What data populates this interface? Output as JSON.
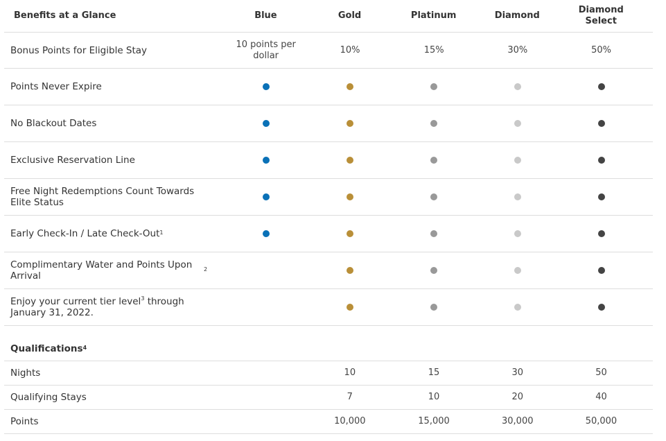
{
  "header": {
    "title": "Benefits at a Glance",
    "tiers": [
      "Blue",
      "Gold",
      "Platinum",
      "Diamond",
      "Diamond Select"
    ]
  },
  "bonus_row": {
    "label": "Bonus Points for Eligible Stay",
    "values": [
      "10 points per dollar",
      "10%",
      "15%",
      "30%",
      "50%"
    ]
  },
  "benefits": [
    {
      "label": "Points Never Expire",
      "sup": "",
      "tiers": [
        true,
        true,
        true,
        true,
        true
      ]
    },
    {
      "label": "No Blackout Dates",
      "sup": "",
      "tiers": [
        true,
        true,
        true,
        true,
        true
      ]
    },
    {
      "label": "Exclusive Reservation Line",
      "sup": "",
      "tiers": [
        true,
        true,
        true,
        true,
        true
      ]
    },
    {
      "label": "Free Night Redemptions Count Towards Elite Status",
      "sup": "",
      "tiers": [
        true,
        true,
        true,
        true,
        true
      ]
    },
    {
      "label": "Early Check-In / Late Check-Out",
      "sup": "1",
      "tiers": [
        true,
        true,
        true,
        true,
        true
      ]
    },
    {
      "label": "Complimentary Water and Points Upon Arrival",
      "sup": "2",
      "tiers": [
        false,
        true,
        true,
        true,
        true
      ]
    },
    {
      "label_before": "Enjoy your current tier level",
      "sup": "3",
      "label_after": " through January 31, 2022.",
      "tiers": [
        false,
        true,
        true,
        true,
        true
      ]
    }
  ],
  "qualifications": {
    "title": "Qualifications",
    "sup": "4",
    "rows": [
      {
        "label": "Nights",
        "values": [
          "",
          "10",
          "15",
          "30",
          "50"
        ]
      },
      {
        "label": "Qualifying Stays",
        "values": [
          "",
          "7",
          "10",
          "20",
          "40"
        ]
      },
      {
        "label": "Points",
        "values": [
          "",
          "10,000",
          "15,000",
          "30,000",
          "50,000"
        ]
      }
    ]
  },
  "colors": {
    "blue": "#0a71b7",
    "gold": "#b98f38",
    "platinum": "#999999",
    "diamond": "#c9c9c9",
    "diamond_select": "#444444"
  }
}
